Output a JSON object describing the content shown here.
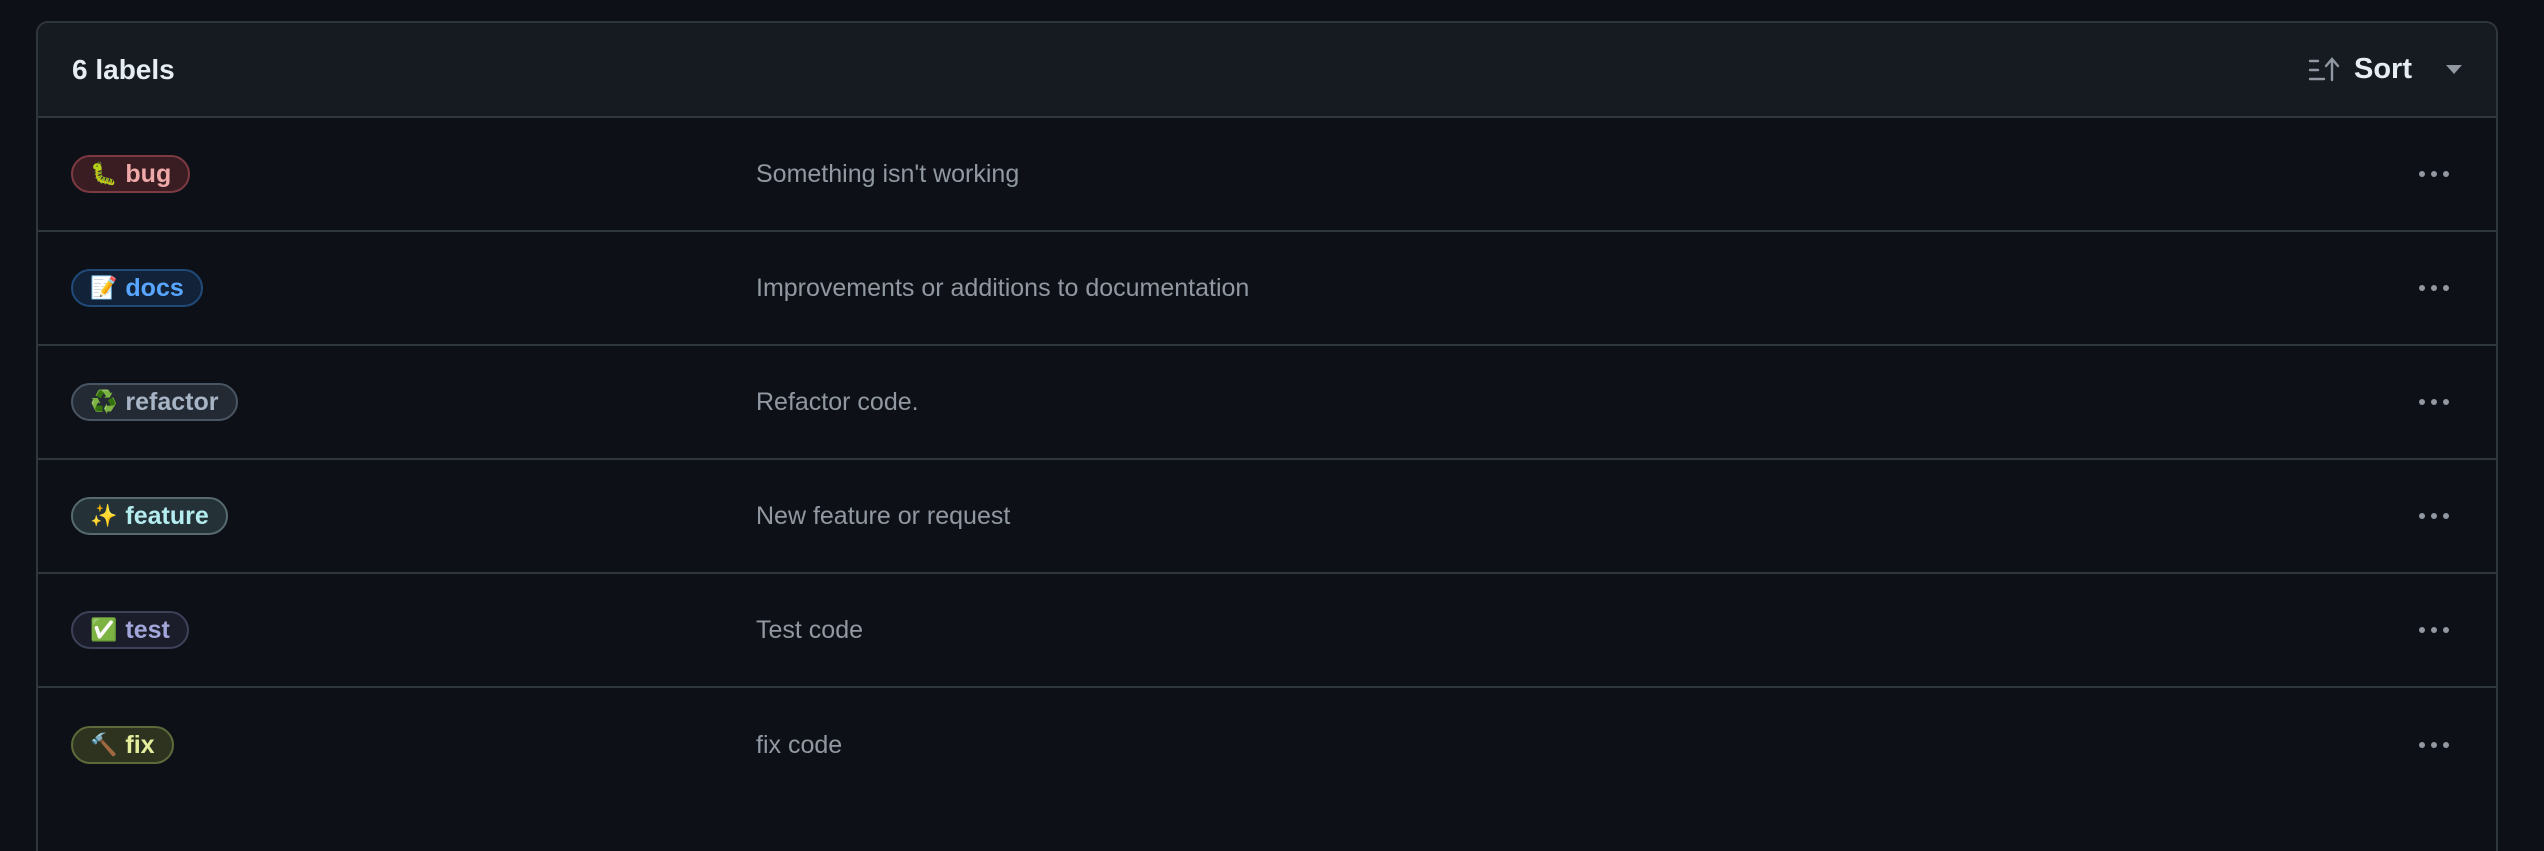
{
  "header": {
    "count_text": "6 labels",
    "sort_label": "Sort",
    "sort_icon": "sort-ascending-icon",
    "dropdown_icon": "triangle-down-icon"
  },
  "labels": [
    {
      "emoji": "🐛",
      "name": "bug",
      "description": "Something isn't working",
      "text_color": "#f0a8a8",
      "bg_color": "#3a1d22",
      "border_color": "#7d3a42"
    },
    {
      "emoji": "📝",
      "name": "docs",
      "description": "Improvements or additions to documentation",
      "text_color": "#58a6ff",
      "bg_color": "#122339",
      "border_color": "#1f4a7a"
    },
    {
      "emoji": "♻️",
      "name": "refactor",
      "description": "Refactor code.",
      "text_color": "#a6b4c6",
      "bg_color": "#232a34",
      "border_color": "#4a5563"
    },
    {
      "emoji": "✨",
      "name": "feature",
      "description": "New feature or request",
      "text_color": "#b4ecf0",
      "bg_color": "#243238",
      "border_color": "#566a70"
    },
    {
      "emoji": "✅",
      "name": "test",
      "description": "Test code",
      "text_color": "#a3a6d9",
      "bg_color": "#1b1d2b",
      "border_color": "#3e4259"
    },
    {
      "emoji": "🔨",
      "name": "fix",
      "description": "fix code",
      "text_color": "#e4ee9c",
      "bg_color": "#2d331f",
      "border_color": "#5d6a3a"
    }
  ],
  "row_action_icon": "kebab-horizontal-icon"
}
